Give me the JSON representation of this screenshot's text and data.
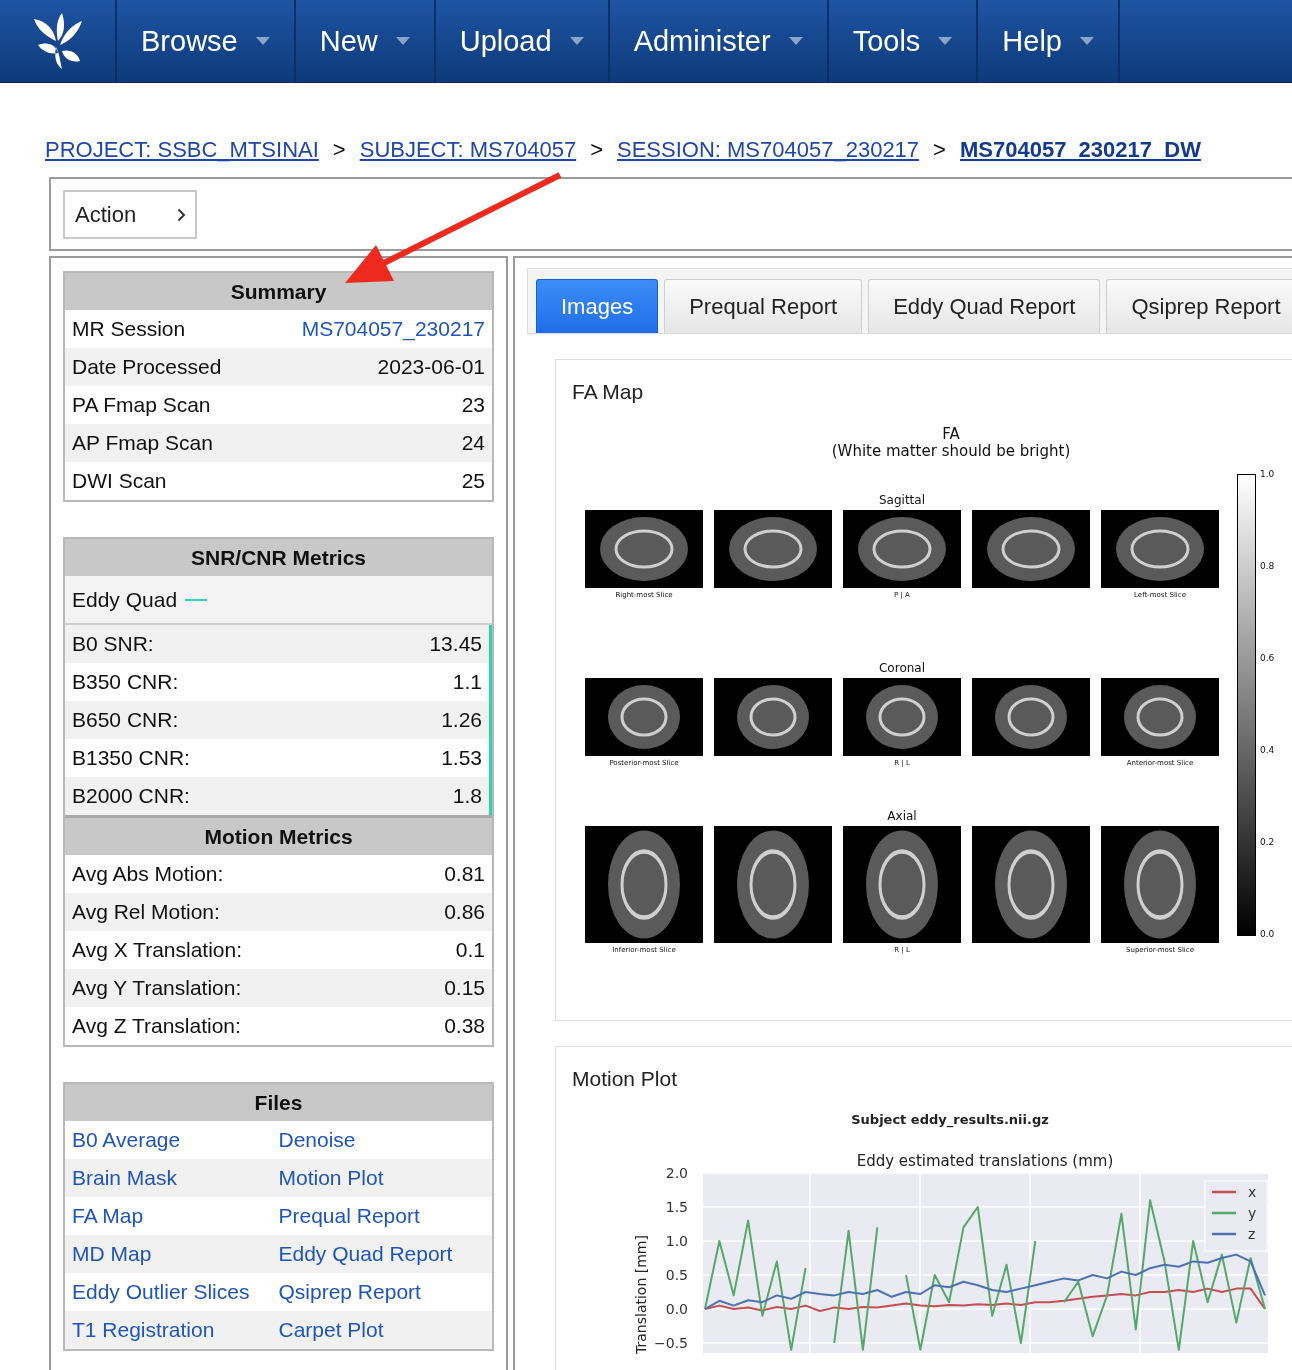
{
  "nav": {
    "items": [
      "Browse",
      "New",
      "Upload",
      "Administer",
      "Tools",
      "Help"
    ]
  },
  "breadcrumb": [
    {
      "kind": "link",
      "text": "PROJECT: SSBC_MTSINAI",
      "current": false
    },
    {
      "kind": "separator",
      "text": ">"
    },
    {
      "kind": "link",
      "text": "SUBJECT: MS704057",
      "current": false
    },
    {
      "kind": "separator",
      "text": ">"
    },
    {
      "kind": "link",
      "text": "SESSION: MS704057_230217",
      "current": false
    },
    {
      "kind": "separator",
      "text": ">"
    },
    {
      "kind": "link",
      "text": "MS704057_230217_DW",
      "current": true
    }
  ],
  "action_button": {
    "label": "Action"
  },
  "summary": {
    "title": "Summary",
    "rows": [
      {
        "label": "MR Session",
        "value": "MS704057_230217",
        "link": true
      },
      {
        "label": "Date Processed",
        "value": "2023-06-01",
        "link": false
      },
      {
        "label": "PA Fmap Scan",
        "value": "23",
        "link": false
      },
      {
        "label": "AP Fmap Scan",
        "value": "24",
        "link": false
      },
      {
        "label": "DWI Scan",
        "value": "25",
        "link": false
      }
    ]
  },
  "snr": {
    "title": "SNR/CNR Metrics",
    "source": "Eddy Quad",
    "rows": [
      {
        "label": "B0 SNR:",
        "value": "13.45"
      },
      {
        "label": "B350 CNR:",
        "value": "1.1"
      },
      {
        "label": "B650 CNR:",
        "value": "1.26"
      },
      {
        "label": "B1350 CNR:",
        "value": "1.53"
      },
      {
        "label": "B2000 CNR:",
        "value": "1.8"
      }
    ]
  },
  "motion": {
    "title": "Motion Metrics",
    "rows": [
      {
        "label": "Avg Abs Motion:",
        "value": "0.81"
      },
      {
        "label": "Avg Rel Motion:",
        "value": "0.86"
      },
      {
        "label": "Avg X Translation:",
        "value": "0.1"
      },
      {
        "label": "Avg Y Translation:",
        "value": "0.15"
      },
      {
        "label": "Avg Z Translation:",
        "value": "0.38"
      }
    ]
  },
  "files": {
    "title": "Files",
    "rows": [
      [
        "B0 Average",
        "Denoise"
      ],
      [
        "Brain Mask",
        "Motion Plot"
      ],
      [
        "FA Map",
        "Prequal Report"
      ],
      [
        "MD Map",
        "Eddy Quad Report"
      ],
      [
        "Eddy Outlier Slices",
        "Qsiprep Report"
      ],
      [
        "T1 Registration",
        "Carpet Plot"
      ]
    ]
  },
  "tabs": [
    {
      "label": "Images",
      "selected": true
    },
    {
      "label": "Prequal Report",
      "selected": false
    },
    {
      "label": "Eddy Quad Report",
      "selected": false
    },
    {
      "label": "Qsiprep Report",
      "selected": false
    }
  ],
  "fa_card": {
    "title": "FA Map",
    "figure": {
      "title_lines": [
        "FA",
        "(White matter should be bright)"
      ],
      "views": [
        {
          "title": "Sagittal",
          "captions": {
            "first": "Right-most Slice",
            "middle": "P | A",
            "last": "Left-most Slice"
          }
        },
        {
          "title": "Coronal",
          "captions": {
            "first": "Posterior-most Slice",
            "middle": "R | L",
            "last": "Anterior-most Slice"
          }
        },
        {
          "title": "Axial",
          "captions": {
            "first": "Inferior-most Slice",
            "middle": "R | L",
            "last": "Superior-most Slice"
          }
        }
      ],
      "colorbar_ticks": [
        "1.0",
        "0.8",
        "0.6",
        "0.4",
        "0.2",
        "0.0"
      ]
    }
  },
  "motion_card": {
    "title": "Motion Plot",
    "figure": {
      "suptitle": "Subject eddy_results.nii.gz",
      "chart_data": {
        "type": "line",
        "title": "Eddy estimated translations (mm)",
        "ylabel": "Translation [mm]",
        "ylim": [
          -0.65,
          2.0
        ],
        "grid": true,
        "legend": true,
        "yticks": [
          {
            "value": 2.0,
            "label": "2.0"
          },
          {
            "value": 1.5,
            "label": "1.5"
          },
          {
            "value": 1.0,
            "label": "1.0"
          },
          {
            "value": 0.5,
            "label": "0.5"
          },
          {
            "value": 0.0,
            "label": "0.0"
          },
          {
            "value": -0.5,
            "label": "−0.5"
          }
        ],
        "series": [
          {
            "name": "x",
            "color": "#c44e52",
            "values": [
              0.0,
              0.05,
              0.0,
              0.02,
              -0.02,
              0.03,
              0.0,
              0.05,
              -0.03,
              0.02,
              0.0,
              0.03,
              0.02,
              0.05,
              0.08,
              0.05,
              0.04,
              0.06,
              0.05,
              0.07,
              0.06,
              0.08,
              0.06,
              0.1,
              0.1,
              0.12,
              0.15,
              0.18,
              0.2,
              0.22,
              0.2,
              0.25,
              0.25,
              0.28,
              0.25,
              0.3,
              0.25,
              0.3,
              0.3,
              0.0
            ]
          },
          {
            "name": "y",
            "color": "#55a868",
            "values": [
              0.0,
              1.0,
              0.2,
              1.3,
              -0.1,
              0.7,
              -0.6,
              0.6,
              null,
              -0.5,
              1.15,
              -0.6,
              1.2,
              null,
              0.5,
              -0.6,
              0.5,
              0.1,
              1.2,
              1.5,
              -0.1,
              0.65,
              -0.5,
              1.0,
              null,
              0.1,
              0.4,
              -0.4,
              0.2,
              1.4,
              -0.3,
              1.6,
              0.7,
              -0.6,
              1.0,
              0.1,
              0.8,
              -0.2,
              0.75,
              0.0
            ]
          },
          {
            "name": "z",
            "color": "#4c72b0",
            "values": [
              0.0,
              0.12,
              0.05,
              0.13,
              0.1,
              0.2,
              0.15,
              0.25,
              0.22,
              0.2,
              0.25,
              0.22,
              0.28,
              0.18,
              0.25,
              0.22,
              0.35,
              0.32,
              0.4,
              0.35,
              0.28,
              0.25,
              0.3,
              0.35,
              0.4,
              0.45,
              0.42,
              0.5,
              0.45,
              0.55,
              0.5,
              0.6,
              0.65,
              0.62,
              0.7,
              0.68,
              0.75,
              0.8,
              0.7,
              0.2
            ]
          }
        ]
      }
    }
  }
}
